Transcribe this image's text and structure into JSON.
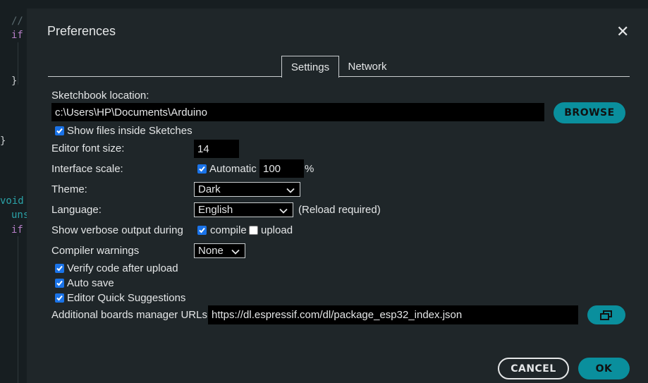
{
  "editor_code": [
    "//",
    "if",
    "}",
    "}",
    "void",
    "uns",
    "if"
  ],
  "dialog": {
    "title": "Preferences",
    "close_icon": "close-icon"
  },
  "tabs": [
    {
      "label": "Settings",
      "active": true
    },
    {
      "label": "Network",
      "active": false
    }
  ],
  "settings": {
    "sketchbook_label": "Sketchbook location:",
    "sketchbook_value": "c:\\Users\\HP\\Documents\\Arduino",
    "browse_label": "BROWSE",
    "show_files_label": "Show files inside Sketches",
    "show_files_checked": true,
    "font_size_label": "Editor font size:",
    "font_size_value": "14",
    "scale_label": "Interface scale:",
    "automatic_label": "Automatic",
    "automatic_checked": true,
    "scale_value": "100",
    "scale_unit": "%",
    "theme_label": "Theme:",
    "theme_value": "Dark",
    "language_label": "Language:",
    "language_value": "English",
    "language_note": "(Reload required)",
    "verbose_label": "Show verbose output during",
    "compile_label": "compile",
    "compile_checked": true,
    "upload_label": "upload",
    "upload_checked": false,
    "warnings_label": "Compiler warnings",
    "warnings_value": "None",
    "verify_label": "Verify code after upload",
    "verify_checked": true,
    "autosave_label": "Auto save",
    "autosave_checked": true,
    "quick_suggest_label": "Editor Quick Suggestions",
    "quick_suggest_checked": true,
    "boards_label": "Additional boards manager URLs:",
    "boards_value": "https://dl.espressif.com/dl/package_esp32_index.json",
    "boards_button_icon": "open-window-icon"
  },
  "footer": {
    "cancel_label": "CANCEL",
    "ok_label": "OK"
  },
  "colors": {
    "accent": "#0a8f9d",
    "checkbox": "#1a73e8",
    "dialog_bg": "#1f2629",
    "field_bg": "#000000"
  }
}
